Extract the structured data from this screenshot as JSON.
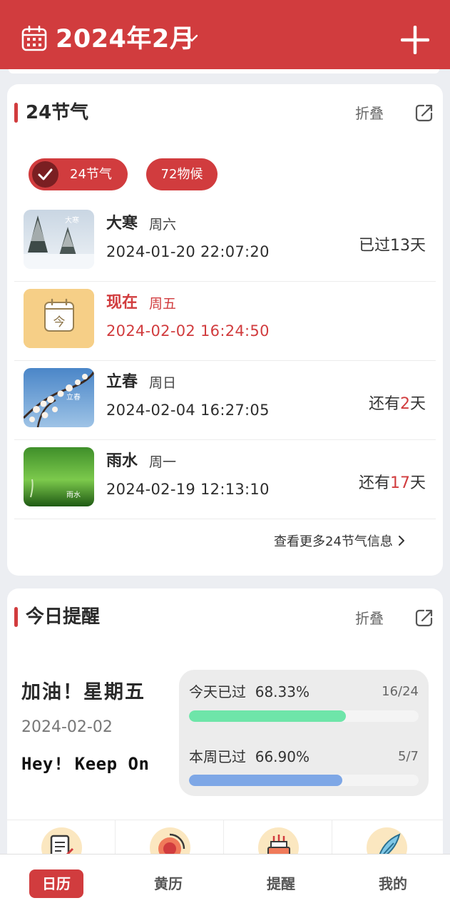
{
  "header": {
    "title": "2024年2月",
    "colors": {
      "primary": "#d13c3e"
    },
    "icons": {
      "left": "calendar-icon",
      "dropdown": "chevron-down-icon",
      "right": "plus-icon"
    }
  },
  "solar_terms_card": {
    "title": "24节气",
    "fold_label": "折叠",
    "chips": [
      {
        "label": "24节气",
        "selected": true
      },
      {
        "label": "72物候",
        "selected": false
      }
    ],
    "rows": [
      {
        "name": "大寒",
        "weekday": "周六",
        "datetime": "2024-01-20 22:07:20",
        "rel_prefix": "已过",
        "rel_num": "13",
        "rel_suffix": "天",
        "thumb_text": "大寒",
        "highlight": false
      },
      {
        "name": "现在",
        "weekday": "周五",
        "datetime": "2024-02-02 16:24:50",
        "rel_prefix": "",
        "rel_num": "",
        "rel_suffix": "",
        "thumb_text": "今",
        "highlight": true
      },
      {
        "name": "立春",
        "weekday": "周日",
        "datetime": "2024-02-04 16:27:05",
        "rel_prefix": "还有",
        "rel_num": "2",
        "rel_suffix": "天",
        "thumb_text": "立春",
        "highlight": false
      },
      {
        "name": "雨水",
        "weekday": "周一",
        "datetime": "2024-02-19 12:13:10",
        "rel_prefix": "还有",
        "rel_num": "17",
        "rel_suffix": "天",
        "thumb_text": "雨水",
        "highlight": false
      }
    ],
    "more_label": "查看更多24节气信息"
  },
  "reminder_card": {
    "title": "今日提醒",
    "fold_label": "折叠",
    "motto": "加油！星期五",
    "date": "2024-02-02",
    "hey": "Hey! Keep On",
    "progress": [
      {
        "label": "今天已过",
        "value_text": "68.33%",
        "count": "16/24",
        "fraction": 0.6833,
        "color": "#6ee5a9"
      },
      {
        "label": "本周已过",
        "value_text": "66.90%",
        "count": "5/7",
        "fraction": 0.669,
        "color": "#7ea7e6"
      }
    ],
    "tools": [
      {
        "icon": "notes-icon"
      },
      {
        "icon": "focus-icon"
      },
      {
        "icon": "birthday-cake-icon"
      },
      {
        "icon": "feather-icon"
      }
    ]
  },
  "bottom_nav": {
    "items": [
      {
        "label": "日历",
        "active": true
      },
      {
        "label": "黄历",
        "active": false
      },
      {
        "label": "提醒",
        "active": false
      },
      {
        "label": "我的",
        "active": false
      }
    ]
  }
}
